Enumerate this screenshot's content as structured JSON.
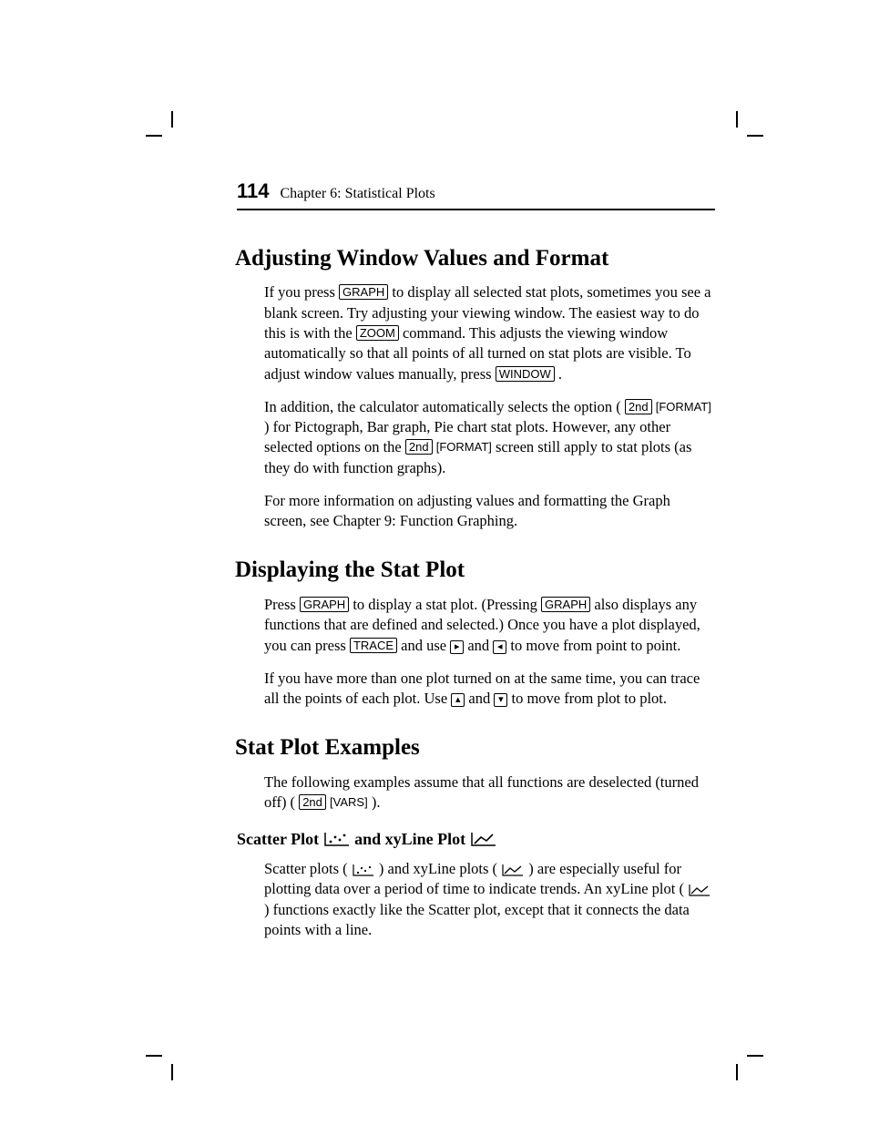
{
  "header": {
    "page_number": "114",
    "chapter": "Chapter 6: Statistical Plots"
  },
  "keys": {
    "graph": "GRAPH",
    "zoom": "ZOOM",
    "window": "WINDOW",
    "second": "2nd",
    "format": "FORMAT",
    "trace": "TRACE",
    "vars": "VARS"
  },
  "s1": {
    "title": "Adjusting Window Values and Format",
    "p1a": "If you press ",
    "p1b": " to display all selected stat plots, sometimes you see a blank screen. Try adjusting your viewing window. The easiest way to do this is with the ",
    "p1c": " command. This adjusts the viewing window automatically so that all points of all turned on stat plots are visible. To adjust window values manually, press ",
    "p1d": ".",
    "p2a": "In addition, the calculator automatically selects the option (",
    "p2b": ") for Pictograph, Bar graph, Pie chart stat plots. However, any other selected options on the ",
    "p2c": " screen still apply to stat plots (as they do with function graphs).",
    "p3": "For more information on adjusting            values and formatting the Graph screen, see Chapter 9: Function Graphing."
  },
  "s2": {
    "title": "Displaying the Stat Plot",
    "p1a": "Press ",
    "p1b": " to display a stat plot. (Pressing ",
    "p1c": " also displays any      functions that are defined and selected.) Once you have a plot displayed, you can press ",
    "p1d": " and use ",
    "p1e": " and ",
    "p1f": " to move from point to point.",
    "p2a": "If you have more than one plot turned on at the same time, you can trace all the points of each plot. Use ",
    "p2b": " and ",
    "p2c": " to move from plot to plot."
  },
  "s3": {
    "title": "Stat Plot Examples",
    "p1a": "The following examples assume that all      functions are deselected (turned off) (",
    "p1b": "                         ).",
    "sub_a": "Scatter Plot ",
    "sub_b": " and xyLine Plot ",
    "p2a": "Scatter plots (",
    "p2b": ") and xyLine plots (",
    "p2c": ") are especially useful for plotting data over a period of time to indicate trends. An xyLine plot (",
    "p2d": ") functions exactly like the Scatter plot, except that it connects the data points with a line."
  }
}
